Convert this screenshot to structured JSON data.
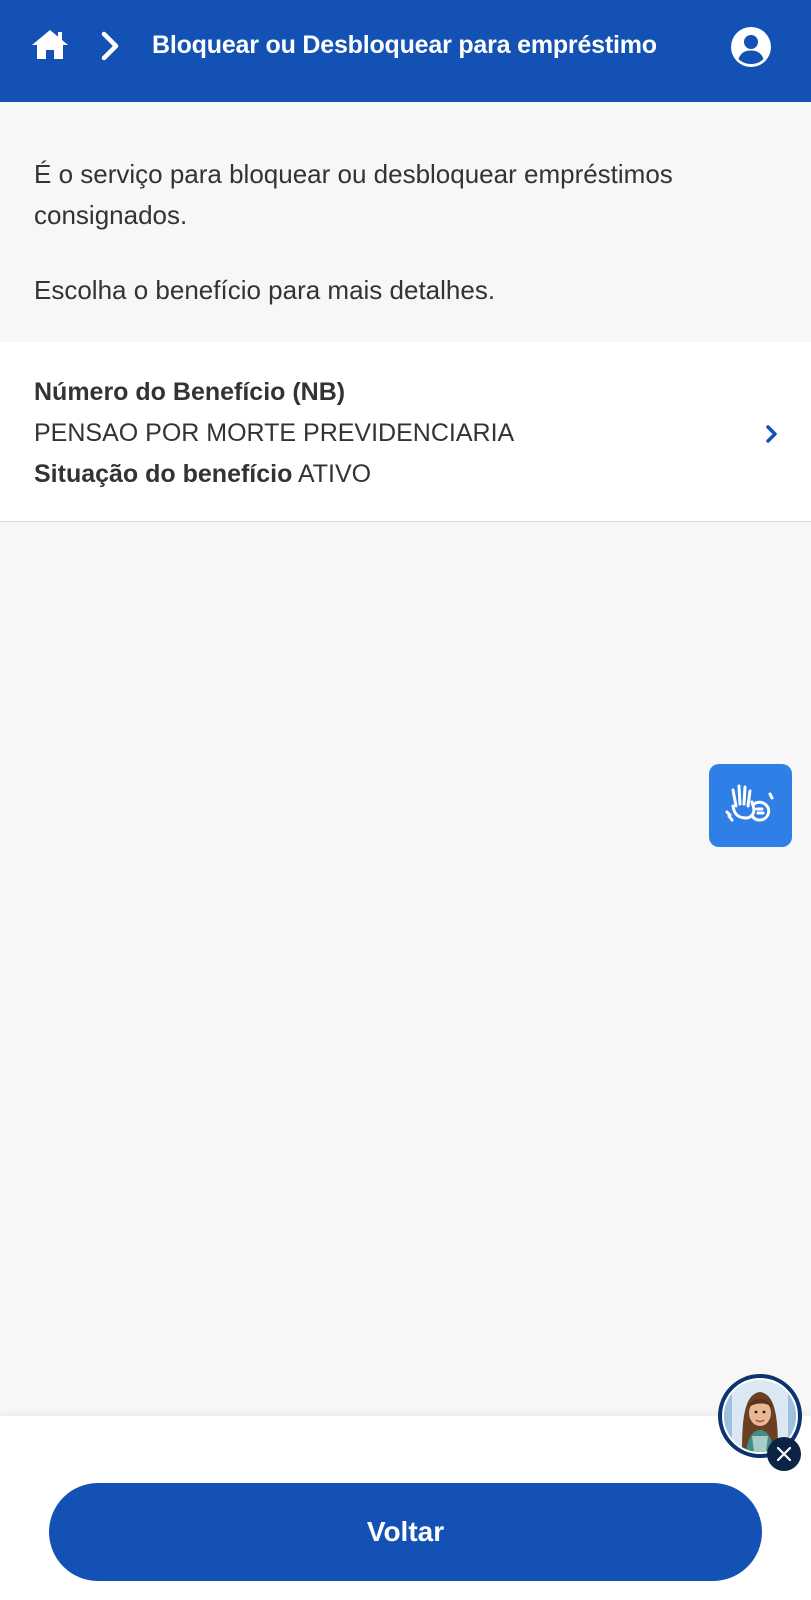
{
  "header": {
    "title": "Bloquear ou Desbloquear para empréstimo",
    "home_icon": "home-icon",
    "separator_icon": "chevron-right-icon",
    "user_icon": "user-circle-icon",
    "background_color": "#1351b4"
  },
  "intro": {
    "description": "É o serviço para bloquear ou desbloquear empréstimos consignados.",
    "instruction": "Escolha o benefício para mais detalhes."
  },
  "benefit": {
    "number_label": "Número do Benefício (NB)",
    "type": "PENSAO POR MORTE PREVIDENCIARIA",
    "status_label": "Situação do benefício",
    "status_value": "ATIVO",
    "action_icon": "chevron-right-icon"
  },
  "accessibility": {
    "vlibras_icon": "sign-language-icon",
    "color": "#2f7fe6"
  },
  "assistant": {
    "avatar_icon": "assistant-avatar",
    "close_icon": "close-icon"
  },
  "footer": {
    "back_label": "Voltar"
  }
}
